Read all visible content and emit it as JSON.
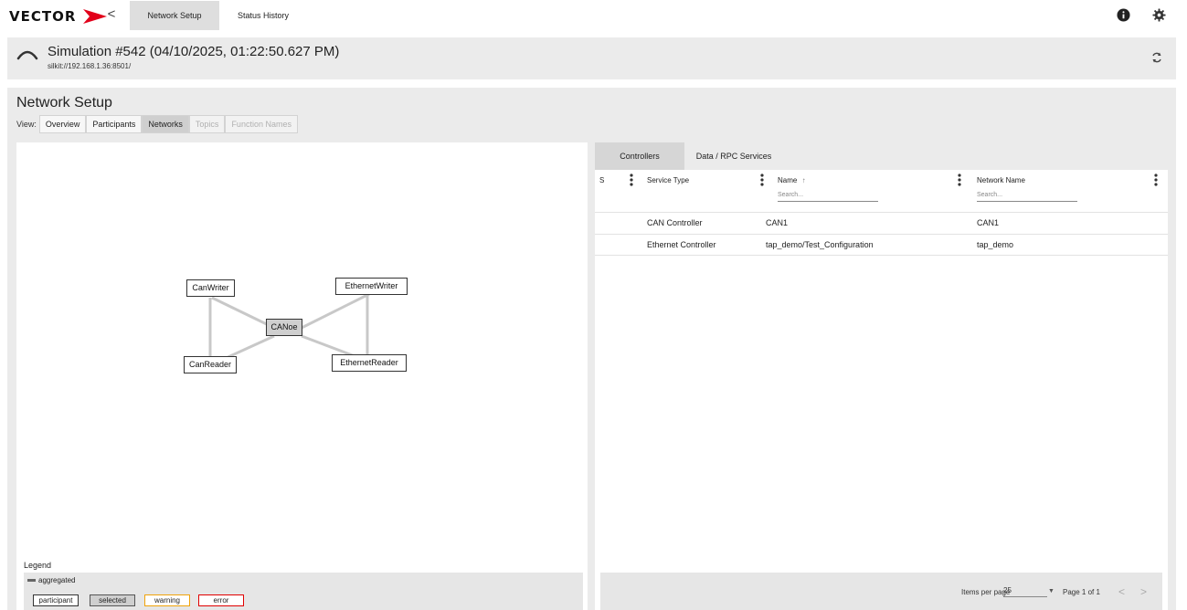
{
  "app": {
    "logo_text": "VECTOR",
    "brand_color": "#e2001a",
    "back_label": "<",
    "tabs": [
      {
        "label": "Network Setup",
        "active": true
      },
      {
        "label": "Status History",
        "active": false
      }
    ],
    "icons": [
      "info-icon",
      "gear-icon"
    ]
  },
  "simulation": {
    "title": "Simulation #542 (04/10/2025, 01:22:50.627 PM)",
    "url": "silkit://192.168.1.36:8501/"
  },
  "page": {
    "title": "Network Setup",
    "view_label": "View:",
    "views": [
      {
        "label": "Overview",
        "state": "normal"
      },
      {
        "label": "Participants",
        "state": "normal"
      },
      {
        "label": "Networks",
        "state": "selected"
      },
      {
        "label": "Topics",
        "state": "disabled"
      },
      {
        "label": "Function Names",
        "state": "disabled"
      }
    ]
  },
  "graph": {
    "nodes": {
      "canwriter": "CanWriter",
      "ethernetwriter": "EthernetWriter",
      "canoe": "CANoe",
      "canreader": "CanReader",
      "ethernetreader": "EthernetReader"
    }
  },
  "legend": {
    "title": "Legend",
    "aggregated": "aggregated",
    "items": [
      {
        "label": "participant",
        "color": "#333333"
      },
      {
        "label": "selected",
        "color": "#555555"
      },
      {
        "label": "warning",
        "color": "#f0a30a"
      },
      {
        "label": "error",
        "color": "#e00000"
      }
    ]
  },
  "table": {
    "tabs": [
      {
        "label": "Controllers",
        "active": true
      },
      {
        "label": "Data / RPC Services",
        "active": false
      }
    ],
    "columns": {
      "status": "S",
      "service_type": "Service Type",
      "name": "Name",
      "name_sort": "↑",
      "network_name": "Network Name"
    },
    "search_placeholder": "Search...",
    "rows": [
      {
        "service_type": "CAN Controller",
        "name": "CAN1",
        "network_name": "CAN1"
      },
      {
        "service_type": "Ethernet Controller",
        "name": "tap_demo/Test_Configuration",
        "network_name": "tap_demo"
      }
    ],
    "paginator": {
      "items_per_page_label": "Items per page",
      "items_per_page": "25",
      "range": "Page 1 of 1",
      "prev": "<",
      "next": ">"
    }
  }
}
